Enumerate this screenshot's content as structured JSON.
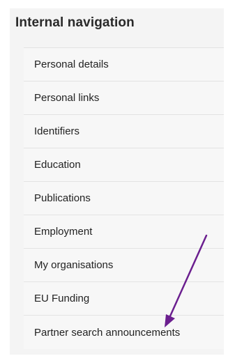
{
  "nav": {
    "title": "Internal navigation",
    "items": [
      {
        "label": "Personal details"
      },
      {
        "label": "Personal links"
      },
      {
        "label": "Identifiers"
      },
      {
        "label": "Education"
      },
      {
        "label": "Publications"
      },
      {
        "label": "Employment"
      },
      {
        "label": "My organisations"
      },
      {
        "label": "EU Funding"
      },
      {
        "label": "Partner search announcements"
      }
    ]
  },
  "annotation": {
    "arrow_color": "#6b1f8f"
  }
}
